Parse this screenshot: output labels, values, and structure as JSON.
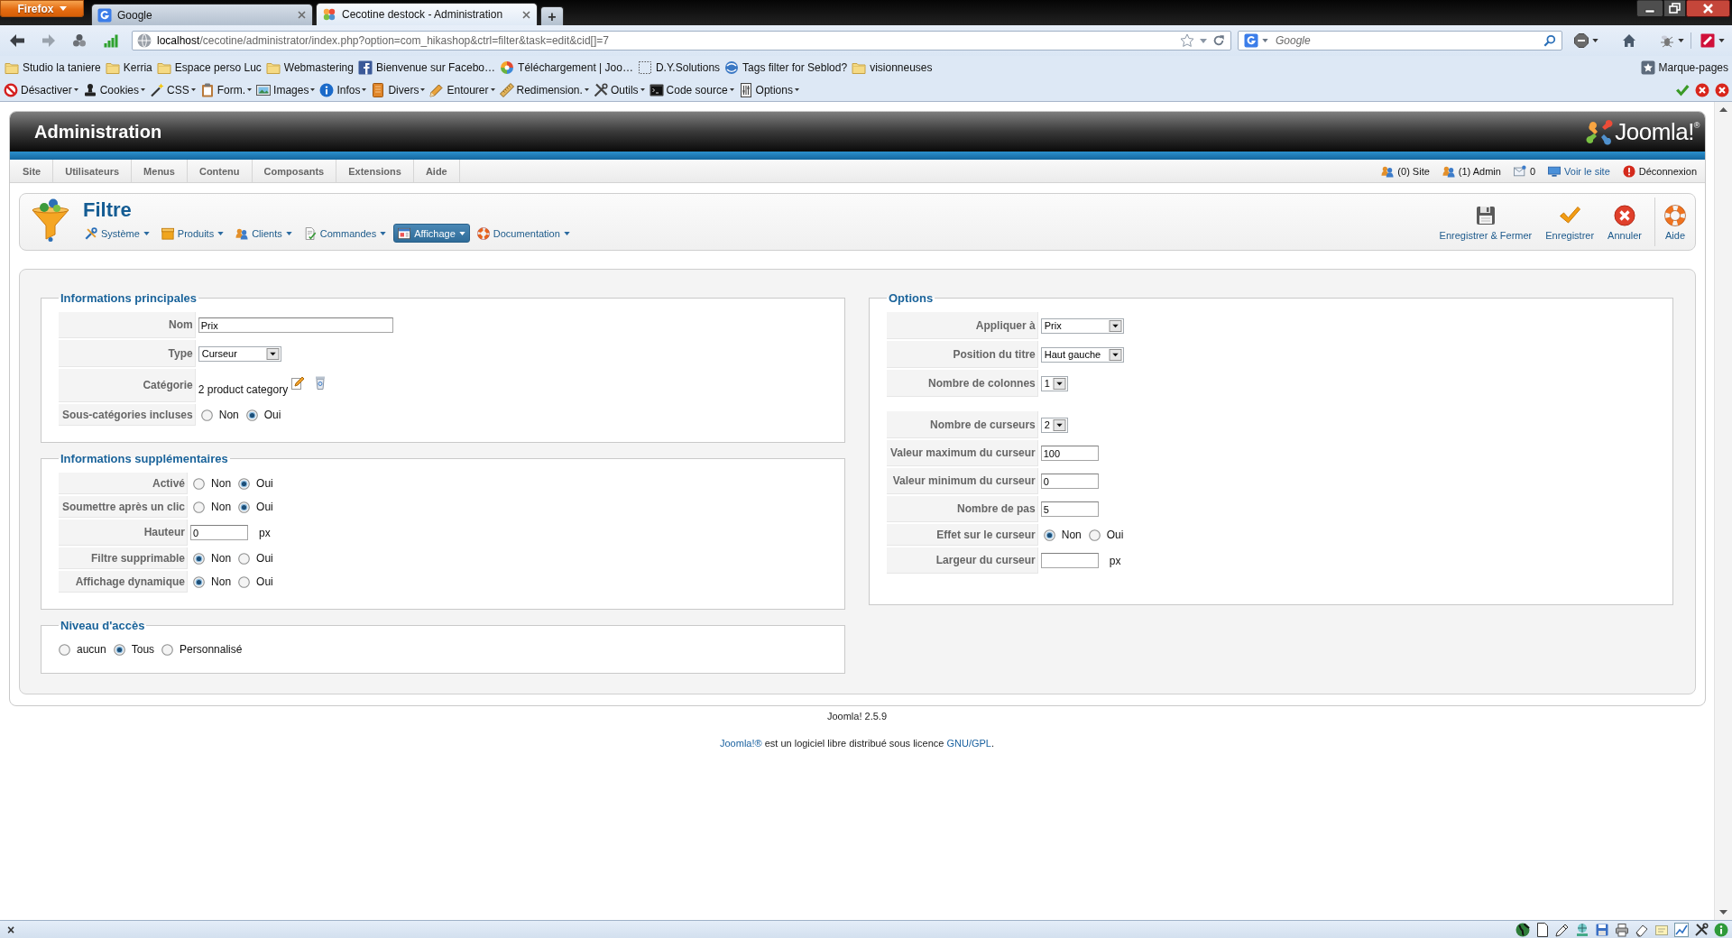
{
  "browser": {
    "app_button": "Firefox",
    "tabs": [
      {
        "title": "Google",
        "selected": false
      },
      {
        "title": "Cecotine destock - Administration",
        "selected": true
      }
    ],
    "new_tab": "+",
    "address": {
      "host": "localhost",
      "path": "/cecotine/administrator/index.php?option=com_hikashop&ctrl=filter&task=edit&cid[]=7"
    },
    "search": {
      "placeholder": "Google"
    },
    "bookmarks": [
      {
        "label": "Studio la taniere",
        "kind": "folder"
      },
      {
        "label": "Kerria",
        "kind": "folder"
      },
      {
        "label": "Espace perso Luc",
        "kind": "folder"
      },
      {
        "label": "Webmastering",
        "kind": "folder"
      },
      {
        "label": "Bienvenue sur Facebo…",
        "kind": "site"
      },
      {
        "label": "Téléchargement | Joo…",
        "kind": "site"
      },
      {
        "label": "D.Y.Solutions",
        "kind": "site"
      },
      {
        "label": "Tags filter for Seblod?",
        "kind": "site"
      },
      {
        "label": "visionneuses",
        "kind": "folder"
      }
    ],
    "bookmarks_menu": "Marque-pages",
    "developer_tools": [
      "Désactiver",
      "Cookies",
      "CSS",
      "Form.",
      "Images",
      "Infos",
      "Divers",
      "Entourer",
      "Redimension.",
      "Outils",
      "Code source",
      "Options"
    ],
    "status_close": "×"
  },
  "admin": {
    "title": "Administration",
    "logo": "Joomla!$^{®}$",
    "menu": [
      "Site",
      "Utilisateurs",
      "Menus",
      "Contenu",
      "Composants",
      "Extensions",
      "Aide"
    ],
    "status": [
      {
        "label": "(0) Site",
        "kind": "users"
      },
      {
        "label": "(1) Admin",
        "kind": "users"
      },
      {
        "label": "0",
        "kind": "messages"
      },
      {
        "label": "Voir le site",
        "kind": "link"
      },
      {
        "label": "Déconnexion",
        "kind": "logout"
      }
    ]
  },
  "toolbar": {
    "title": "Filtre",
    "submenu": [
      {
        "label": "Système",
        "selected": false
      },
      {
        "label": "Produits",
        "selected": false
      },
      {
        "label": "Clients",
        "selected": false
      },
      {
        "label": "Commandes",
        "selected": false
      },
      {
        "label": "Affichage",
        "selected": true
      },
      {
        "label": "Documentation",
        "selected": false
      }
    ],
    "actions": [
      {
        "label": "Enregistrer & Fermer",
        "kind": "save-close"
      },
      {
        "label": "Enregistrer",
        "kind": "save"
      },
      {
        "label": "Annuler",
        "kind": "cancel"
      },
      {
        "label": "Aide",
        "kind": "help"
      }
    ]
  },
  "columns": [
    [
      {
        "legend": "Informations principales",
        "kind": "form",
        "rows": [
          {
            "label": "Nom",
            "kind": "text",
            "value": "Prix"
          },
          {
            "label": "Type",
            "kind": "select",
            "value": "Curseur"
          },
          {
            "label": "Catégorie",
            "kind": "category",
            "value": "2 product category"
          },
          {
            "label": "Sous-catégories incluses",
            "kind": "radio",
            "options": [
              {
                "label": "Non",
                "selected": false
              },
              {
                "label": "Oui",
                "selected": true
              }
            ]
          }
        ]
      },
      {
        "legend": "Informations supplémentaires",
        "kind": "form",
        "rows": [
          {
            "label": "Activé",
            "kind": "radio",
            "options": [
              {
                "label": "Non",
                "selected": false
              },
              {
                "label": "Oui",
                "selected": true
              }
            ]
          },
          {
            "label": "Soumettre après un clic",
            "kind": "radio",
            "options": [
              {
                "label": "Non",
                "selected": false
              },
              {
                "label": "Oui",
                "selected": true
              }
            ]
          },
          {
            "label": "Hauteur",
            "kind": "number",
            "value": "0",
            "unit": "px"
          },
          {
            "label": "Filtre supprimable",
            "kind": "radio",
            "options": [
              {
                "label": "Non",
                "selected": true
              },
              {
                "label": "Oui",
                "selected": false
              }
            ]
          },
          {
            "label": "Affichage dynamique",
            "kind": "radio",
            "options": [
              {
                "label": "Non",
                "selected": true
              },
              {
                "label": "Oui",
                "selected": false
              }
            ]
          }
        ]
      },
      {
        "legend": "Niveau d'accès",
        "kind": "choices",
        "options": [
          {
            "label": "aucun",
            "selected": false
          },
          {
            "label": "Tous",
            "selected": true
          },
          {
            "label": "Personnalisé",
            "selected": false
          }
        ]
      }
    ],
    [
      {
        "legend": "Options",
        "kind": "form",
        "rows": [
          {
            "label": "Appliquer à",
            "kind": "select",
            "value": "Prix"
          },
          {
            "label": "Position du titre",
            "kind": "select",
            "value": "Haut gauche"
          },
          {
            "label": "Nombre de colonnes",
            "kind": "select",
            "value": "1"
          },
          {
            "label": "Nombre de curseurs",
            "kind": "select",
            "value": "2",
            "gap_before": true
          },
          {
            "label": "Valeur maximum du curseur",
            "kind": "number",
            "value": "100"
          },
          {
            "label": "Valeur minimum du curseur",
            "kind": "number",
            "value": "0"
          },
          {
            "label": "Nombre de pas",
            "kind": "number",
            "value": "5"
          },
          {
            "label": "Effet sur le curseur",
            "kind": "radio",
            "options": [
              {
                "label": "Non",
                "selected": true
              },
              {
                "label": "Oui",
                "selected": false
              }
            ]
          },
          {
            "label": "Largeur du curseur",
            "kind": "number",
            "unit": "px"
          }
        ]
      }
    ]
  ],
  "footer": {
    "version": "Joomla! 2.5.9",
    "licence": [
      {
        "text": "Joomla!®",
        "kind": "link"
      },
      {
        "text": " est un logiciel libre distribué sous licence ",
        "kind": "text"
      },
      {
        "text": "GNU/GPL",
        "kind": "link"
      },
      {
        "text": ".",
        "kind": "text"
      }
    ]
  }
}
